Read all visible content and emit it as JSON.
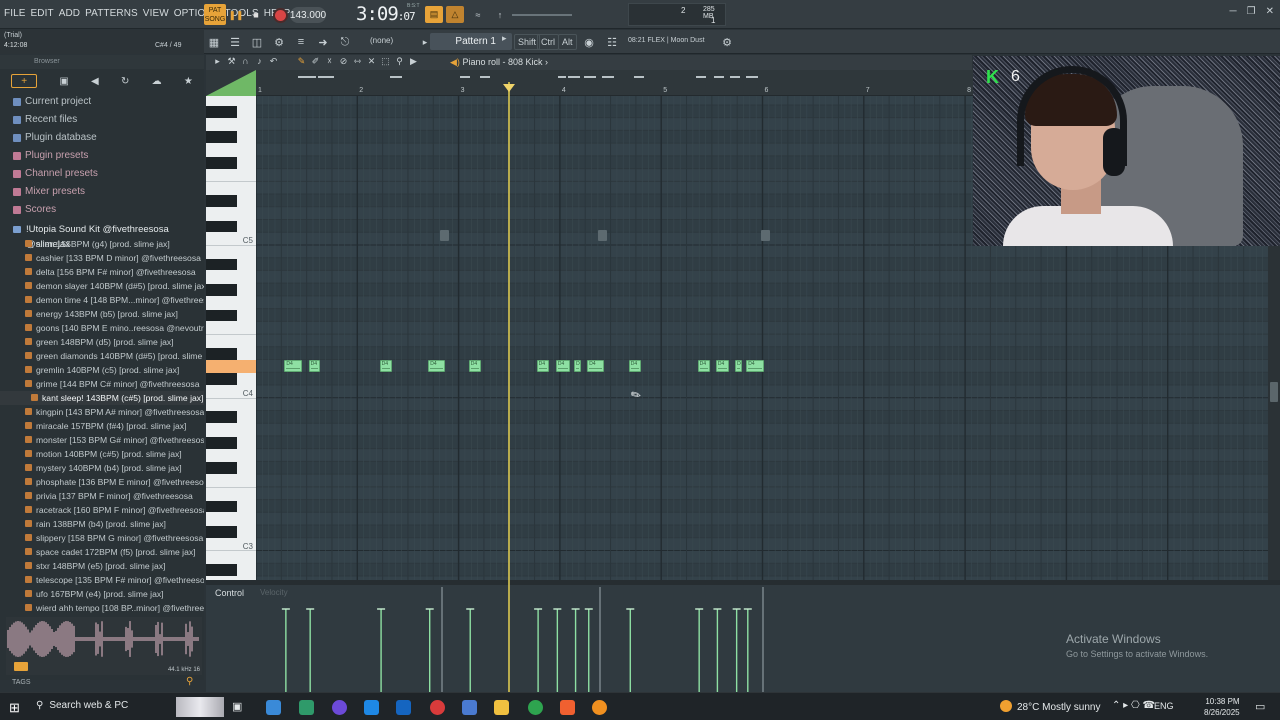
{
  "menu": [
    "FILE",
    "EDIT",
    "ADD",
    "PATTERNS",
    "VIEW",
    "OPTIONS",
    "TOOLS",
    "HELP"
  ],
  "transport": {
    "pat_label": "PAT",
    "song_label": "SONG",
    "tempo": "143.000",
    "time_main": "3:09",
    "time_sub": ":07",
    "time_mode": "B:S:T",
    "cpu_value": "2",
    "memory": "285 MB",
    "polyphony": "1"
  },
  "hint": {
    "line1": "(Trial)",
    "line2": "4:12:08",
    "note": "C#4 / 49"
  },
  "toolbar": {
    "pattern_name": "Pattern 1",
    "snap": "(none)",
    "shift": "Shift",
    "ctrl": "Ctrl",
    "alt": "Alt",
    "flex": "08:21  FLEX | Moon Dust"
  },
  "browser": {
    "header": "Browser",
    "categories": [
      {
        "label": "Current project",
        "kind": "blue"
      },
      {
        "label": "Recent files",
        "kind": "blue"
      },
      {
        "label": "Plugin database",
        "kind": "blue"
      },
      {
        "label": "Plugin presets",
        "kind": "pink"
      },
      {
        "label": "Channel presets",
        "kind": "pink"
      },
      {
        "label": "Mixer presets",
        "kind": "pink"
      },
      {
        "label": "Scores",
        "kind": "pink"
      }
    ],
    "pack": "!Utopia Sound Kit @fivethreesosa @slimejax",
    "files": [
      "alien 155BPM (g4) [prod. slime jax]",
      "cashier [133 BPM D minor] @fivethreesosa",
      "delta [156 BPM F# minor] @fivethreesosa",
      "demon slayer 140BPM (d#5) [prod. slime jax]",
      "demon time 4 [148 BPM...minor] @fivethreesosa",
      "energy 143BPM (b5) [prod. slime jax]",
      "goons [140 BPM E mino..reesosa @nevoutrippin'",
      "green 148BPM (d5) [prod. slime jax]",
      "green diamonds 140BPM (d#5) [prod. slime jax]",
      "gremlin 140BPM (c5) [prod. slime jax]",
      "grime [144 BPM C# minor] @fivethreesosa",
      "kant sleep! 143BPM (c#5) [prod. slime jax]",
      "kingpin [143 BPM A# minor] @fivethreesosa",
      "miracale 157BPM (f#4) [prod. slime jax]",
      "monster [153 BPM G# minor] @fivethreesosa",
      "motion 140BPM (c#5) [prod. slime jax]",
      "mystery 140BPM (b4) [prod. slime jax]",
      "phosphate [136 BPM E minor] @fivethreesosa",
      "privia [137 BPM F minor] @fivethreesosa",
      "racetrack [160 BPM F minor] @fivethreesosa",
      "rain 138BPM (b4) [prod. slime jax]",
      "slippery [158 BPM G minor] @fivethreesosa",
      "space cadet 172BPM (f5) [prod. slime jax]",
      "stxr 148BPM (e5) [prod. slime jax]",
      "telescope [135 BPM F# minor] @fivethreesosa",
      "ufo 167BPM (e4) [prod. slime jax]",
      "wierd ahh tempo [108 BP..minor] @fivethreesosa"
    ],
    "selected_index": 11,
    "sample_info": "44.1 kHz 16",
    "tags_label": "TAGS"
  },
  "piano_roll": {
    "title": "Piano roll - 808 Kick",
    "bars": [
      "1",
      "2",
      "3",
      "4",
      "5",
      "6",
      "7",
      "8"
    ],
    "key_labels": [
      "C5",
      "C4",
      "C3"
    ],
    "note_label": "D4",
    "notes": [
      {
        "start": 0.28,
        "len": 0.17
      },
      {
        "start": 0.52,
        "len": 0.11
      },
      {
        "start": 1.22,
        "len": 0.12
      },
      {
        "start": 1.7,
        "len": 0.17
      },
      {
        "start": 2.1,
        "len": 0.12
      },
      {
        "start": 2.77,
        "len": 0.12
      },
      {
        "start": 2.96,
        "len": 0.14
      },
      {
        "start": 3.14,
        "len": 0.07
      },
      {
        "start": 3.27,
        "len": 0.17
      },
      {
        "start": 3.68,
        "len": 0.12
      },
      {
        "start": 4.36,
        "len": 0.12
      },
      {
        "start": 4.54,
        "len": 0.13
      },
      {
        "start": 4.73,
        "len": 0.07
      },
      {
        "start": 4.84,
        "len": 0.17
      }
    ],
    "velocity_label": "Control",
    "velocity_sub": "Velocity"
  },
  "webcam": {
    "badge": "K",
    "count": "6"
  },
  "watermark": {
    "title": "Activate Windows",
    "sub": "Go to Settings to activate Windows."
  },
  "taskbar": {
    "search": "Search web & PC",
    "weather": "28°C  Mostly sunny",
    "lang": "ENG",
    "time": "10:38 PM",
    "date": "8/26/2025"
  },
  "colors": {
    "accent": "#e7a339",
    "note": "#8ee0a3",
    "grid": "#34424a",
    "playhead": "#d0c050"
  }
}
